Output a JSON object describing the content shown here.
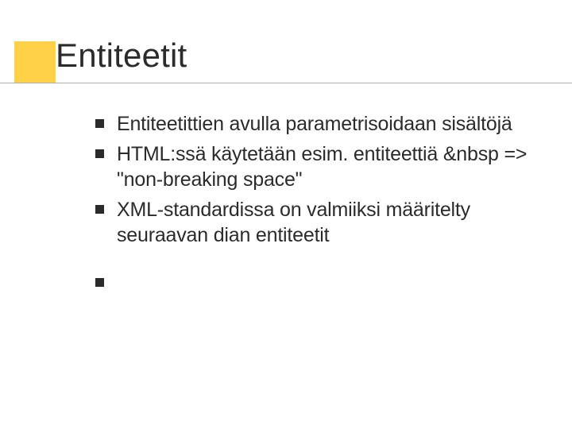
{
  "slide": {
    "title": "Entiteetit",
    "bullets": [
      "Entiteetittien avulla parametrisoidaan sisältöjä",
      "HTML:ssä käytetään esim. entiteettiä &nbsp => \"non-breaking space\"",
      "XML-standardissa on valmiiksi määritelty seuraavan dian entiteetit",
      ""
    ]
  }
}
